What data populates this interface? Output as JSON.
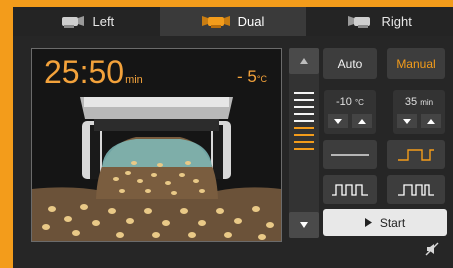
{
  "tabs": [
    {
      "label": "Left",
      "active": false,
      "icon": "head-left-icon"
    },
    {
      "label": "Dual",
      "active": true,
      "icon": "head-dual-icon"
    },
    {
      "label": "Right",
      "active": false,
      "icon": "head-right-icon"
    }
  ],
  "viewer": {
    "time": "25:50",
    "time_unit": "min",
    "temperature": "- 5",
    "temperature_unit": "°C"
  },
  "level": {
    "total": 9,
    "white": 5,
    "warm": 4
  },
  "mode": {
    "auto_label": "Auto",
    "manual_label": "Manual"
  },
  "settings": {
    "temp_value": "-10",
    "temp_unit": "°C",
    "time_value": "35",
    "time_unit": "min"
  },
  "waveforms": [
    "flat-line-icon",
    "square-wave-icon",
    "pulse-train-icon",
    "burst-wave-icon"
  ],
  "start_label": "Start",
  "colors": {
    "accent": "#f39c1b",
    "background": "#262626"
  }
}
